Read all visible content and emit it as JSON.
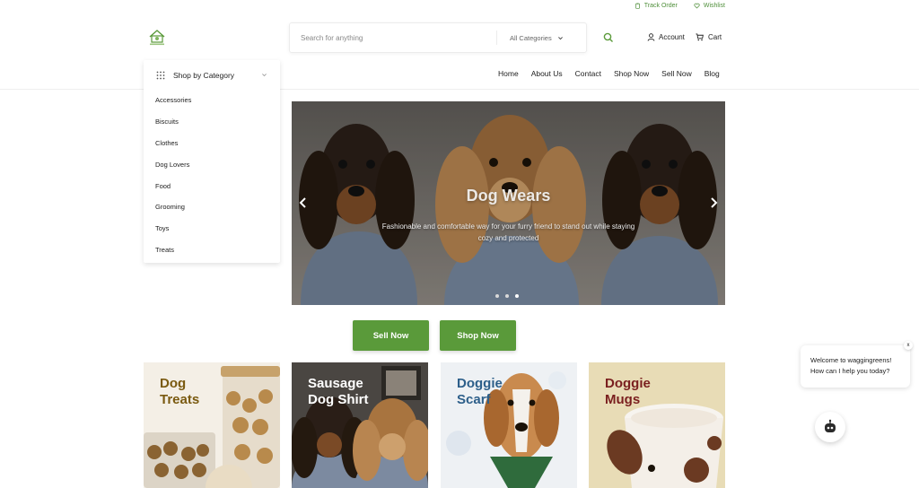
{
  "topbar": {
    "track_order": "Track Order",
    "wishlist": "Wishlist"
  },
  "search": {
    "placeholder": "Search for anything",
    "category": "All Categories"
  },
  "header": {
    "account": "Account",
    "cart": "Cart"
  },
  "categories": {
    "title": "Shop by Category",
    "items": [
      "Accessories",
      "Biscuits",
      "Clothes",
      "Dog Lovers",
      "Food",
      "Grooming",
      "Toys",
      "Treats"
    ]
  },
  "nav": [
    "Home",
    "About Us",
    "Contact",
    "Shop Now",
    "Sell Now",
    "Blog"
  ],
  "hero": {
    "title": "Dog Wears",
    "subtitle": "Fashionable and comfortable way for your furry friend to stand out while staying cozy and protected",
    "slides": 3,
    "active_slide": 1
  },
  "cta": {
    "sell": "Sell Now",
    "shop": "Shop Now"
  },
  "tiles": [
    {
      "label": "Dog\nTreats",
      "color": "#7a5a10"
    },
    {
      "label": "Sausage\nDog Shirt",
      "color": "#ffffff"
    },
    {
      "label": "Doggie\nScarf",
      "color": "#2d5f8a"
    },
    {
      "label": "Doggie\nMugs",
      "color": "#7a1f1f"
    }
  ],
  "chat": {
    "message": "Welcome to waggingreens!\nHow can I help you today?",
    "close": "x"
  },
  "colors": {
    "brand_green": "#5a9a3a",
    "accent_green": "#4f8f3a"
  }
}
